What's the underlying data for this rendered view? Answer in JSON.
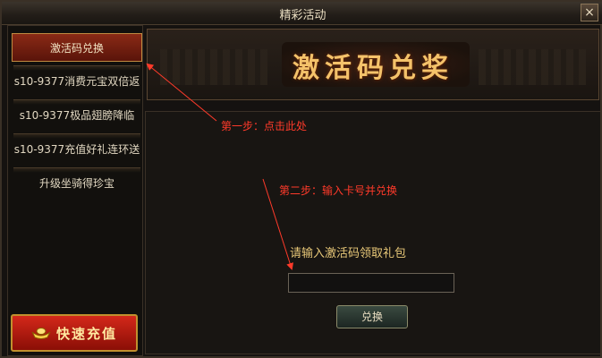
{
  "window": {
    "title": "精彩活动",
    "close_label": "×"
  },
  "sidebar": {
    "items": [
      {
        "label": "激活码兑换",
        "active": true
      },
      {
        "label": "s10-9377消费元宝双倍返",
        "active": false
      },
      {
        "label": "s10-9377极品翅膀降临",
        "active": false
      },
      {
        "label": "s10-9377充值好礼连环送",
        "active": false
      },
      {
        "label": "升级坐骑得珍宝",
        "active": false
      }
    ],
    "recharge_label": "快速充值"
  },
  "banner": {
    "title": "激活码兑奖"
  },
  "annotations": {
    "step1": "第一步：点击此处",
    "step2": "第二步：输入卡号并兑换"
  },
  "form": {
    "prompt": "请输入激活码领取礼包",
    "code_value": "",
    "redeem_label": "兑换"
  },
  "colors": {
    "accent_red": "#ff3a2a",
    "gold": "#f4c26a",
    "active_item": "#8a2a16"
  }
}
